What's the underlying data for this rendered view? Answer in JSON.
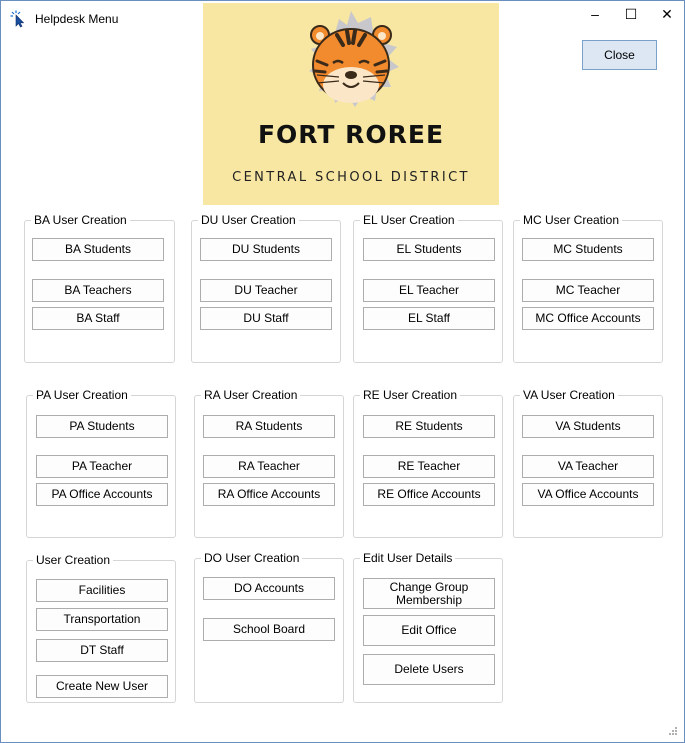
{
  "window": {
    "title": "Helpdesk Menu",
    "min_glyph": "–",
    "max_glyph": "☐",
    "close_glyph": "✕"
  },
  "banner": {
    "title": "FORT ROREE",
    "subtitle": "CENTRAL SCHOOL DISTRICT"
  },
  "close_button": "Close",
  "groups": {
    "ba": {
      "label": "BA User Creation",
      "buttons": [
        "BA Students",
        "BA Teachers",
        "BA Staff"
      ]
    },
    "du": {
      "label": "DU User Creation",
      "buttons": [
        "DU Students",
        "DU Teacher",
        "DU Staff"
      ]
    },
    "el": {
      "label": "EL User Creation",
      "buttons": [
        "EL Students",
        "EL Teacher",
        "EL Staff"
      ]
    },
    "mc": {
      "label": "MC User Creation",
      "buttons": [
        "MC Students",
        "MC Teacher",
        "MC Office Accounts"
      ]
    },
    "pa": {
      "label": "PA User Creation",
      "buttons": [
        "PA Students",
        "PA Teacher",
        "PA Office Accounts"
      ]
    },
    "ra": {
      "label": "RA User Creation",
      "buttons": [
        "RA Students",
        "RA Teacher",
        "RA Office Accounts"
      ]
    },
    "re": {
      "label": "RE User Creation",
      "buttons": [
        "RE Students",
        "RE Teacher",
        "RE Office Accounts"
      ]
    },
    "va": {
      "label": "VA User Creation",
      "buttons": [
        "VA Students",
        "VA Teacher",
        "VA Office Accounts"
      ]
    },
    "user": {
      "label": "User Creation",
      "buttons": [
        "Facilities",
        "Transportation",
        "DT Staff",
        "Create New User"
      ]
    },
    "do": {
      "label": "DO User Creation",
      "buttons": [
        "DO Accounts",
        "School Board"
      ]
    },
    "edit": {
      "label": "Edit User Details",
      "buttons": [
        "Change Group Membership",
        "Edit Office",
        "Delete Users"
      ]
    }
  },
  "colors": {
    "banner_bg": "#f8e7a3",
    "close_button_bg": "#dde7f3",
    "tiger_orange": "#f28a2e"
  }
}
